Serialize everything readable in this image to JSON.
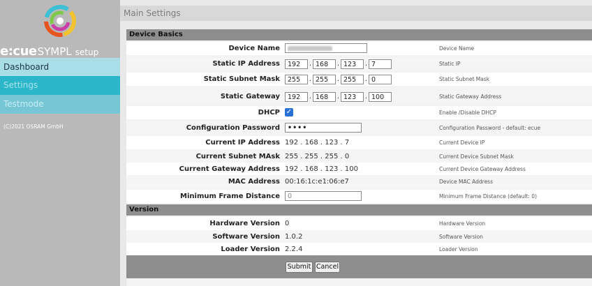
{
  "brand": {
    "part1": "e:cue",
    "part2": "SYMPL",
    "part3": "setup"
  },
  "nav": [
    {
      "label": "Dashboard",
      "active": false
    },
    {
      "label": "Settings",
      "active": true
    },
    {
      "label": "Testmode",
      "active": false
    }
  ],
  "copyright": "(C)2021 OSRAM GmbH",
  "page_title": "Main Settings",
  "sections": {
    "device_basics": "Device Basics",
    "version": "Version"
  },
  "device_basics": {
    "device_name": {
      "label": "Device Name",
      "description": "Device Name"
    },
    "static_ip": {
      "label": "Static IP Address",
      "octets": [
        "192",
        "168",
        "123",
        "7"
      ],
      "description": "Static IP"
    },
    "subnet_mask": {
      "label": "Static Subnet Mask",
      "octets": [
        "255",
        "255",
        "255",
        "0"
      ],
      "description": "Static Subnet Mask"
    },
    "gateway": {
      "label": "Static Gateway",
      "octets": [
        "192",
        "168",
        "123",
        "100"
      ],
      "description": "Static Gateway Address"
    },
    "dhcp": {
      "label": "DHCP",
      "checked": true,
      "description": "Enable /Disable DHCP"
    },
    "config_password": {
      "label": "Configuration Password",
      "value": "••••",
      "description": "Configuration Password - default: ecue"
    },
    "current_ip": {
      "label": "Current IP Address",
      "value": "192 . 168 . 123 . 7",
      "description": "Current Device IP"
    },
    "current_subnet": {
      "label": "Current Subnet MAsk",
      "value": "255 . 255 . 255 . 0",
      "description": "Current Device Subnet Mask"
    },
    "current_gateway": {
      "label": "Current Gateway Address",
      "value": "192 . 168 . 123 . 100",
      "description": "Current Device Gateway Address"
    },
    "mac": {
      "label": "MAC Address",
      "value": "00:16:1c:e1:06:e7",
      "description": "Device MAC Address"
    },
    "min_frame": {
      "label": "Minimum Frame Distance",
      "value": "0",
      "description": "Minimum Frame Distance (default: 0)"
    }
  },
  "version": {
    "hardware": {
      "label": "Hardware Version",
      "value": "0",
      "description": "Hardware Version"
    },
    "software": {
      "label": "Software Version",
      "value": "1.0.2",
      "description": "Software Version"
    },
    "loader": {
      "label": "Loader Version",
      "value": "2.2.4",
      "description": "Loader Version"
    }
  },
  "buttons": {
    "submit": "Submit",
    "cancel": "Cancel"
  },
  "colors": {
    "sidebar": "#b9b9b9",
    "nav_active": "#2bb6c9",
    "section_bar": "#8e8e8e",
    "checkbox": "#2a71d6"
  }
}
